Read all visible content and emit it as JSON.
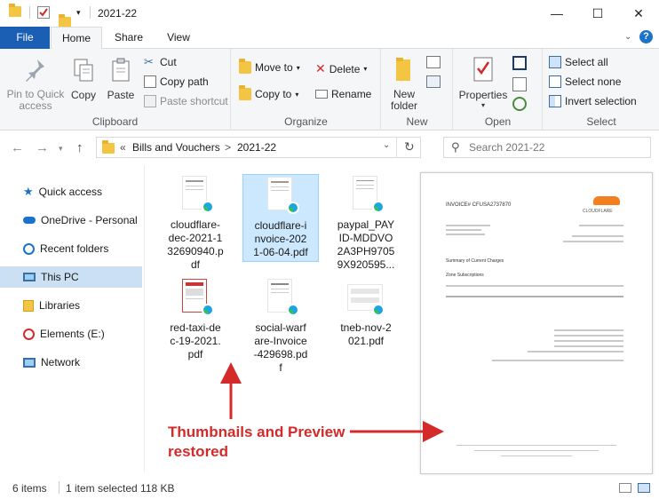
{
  "window": {
    "title": "2021-22",
    "controls": {
      "minimize": "—",
      "maximize": "☐",
      "close": "✕"
    }
  },
  "tabs": {
    "file": "File",
    "home": "Home",
    "share": "Share",
    "view": "View"
  },
  "ribbon": {
    "clipboard": {
      "label": "Clipboard",
      "pin": "Pin to Quick access",
      "copy": "Copy",
      "paste": "Paste",
      "cut": "Cut",
      "copy_path": "Copy path",
      "paste_shortcut": "Paste shortcut"
    },
    "organize": {
      "label": "Organize",
      "move_to": "Move to",
      "copy_to": "Copy to",
      "delete": "Delete",
      "rename": "Rename"
    },
    "new": {
      "label": "New",
      "new_folder": "New folder"
    },
    "open": {
      "label": "Open",
      "properties": "Properties"
    },
    "select": {
      "label": "Select",
      "select_all": "Select all",
      "select_none": "Select none",
      "invert": "Invert selection"
    }
  },
  "address": {
    "breadcrumb_root": "Bills and Vouchers",
    "breadcrumb_current": "2021-22",
    "separator": ">",
    "search_placeholder": "Search 2021-22"
  },
  "sidebar": {
    "items": [
      {
        "label": "Quick access",
        "icon": "star-icon"
      },
      {
        "label": "OneDrive - Personal",
        "icon": "cloud-icon"
      },
      {
        "label": "Recent folders",
        "icon": "recent-folder-icon"
      },
      {
        "label": "This PC",
        "icon": "pc-icon"
      },
      {
        "label": "Libraries",
        "icon": "library-icon"
      },
      {
        "label": "Elements (E:)",
        "icon": "drive-icon"
      },
      {
        "label": "Network",
        "icon": "network-icon"
      }
    ]
  },
  "files": [
    {
      "name": "cloudflare-dec-2021-132690940.pdf",
      "lines": [
        "cloudflare-",
        "dec-2021-1",
        "32690940.p",
        "df"
      ]
    },
    {
      "name": "cloudflare-invoice-2021-06-04.pdf",
      "lines": [
        "cloudflare-i",
        "nvoice-202",
        "1-06-04.pdf"
      ]
    },
    {
      "name": "paypal_PAYID-MDDVO2A3PH97059X920595...",
      "lines": [
        "paypal_PAY",
        "ID-MDDVO",
        "2A3PH9705",
        "9X920595..."
      ]
    },
    {
      "name": "red-taxi-dec-19-2021.pdf",
      "lines": [
        "red-taxi-de",
        "c-19-2021.",
        "pdf"
      ]
    },
    {
      "name": "social-warfare-Invoice-429698.pdf",
      "lines": [
        "social-warf",
        "are-Invoice",
        "-429698.pd",
        "f"
      ]
    },
    {
      "name": "tneb-nov-2021.pdf",
      "lines": [
        "tneb-nov-2",
        "021.pdf"
      ]
    }
  ],
  "preview": {
    "invoice_title": "INVOICE# CFUSA2737870",
    "brand": "CLOUDFLARE",
    "summary": "Summary of Current Charges",
    "zone": "Zone Subscriptions"
  },
  "annotation": {
    "line1": "Thumbnails and Preview",
    "line2": "restored"
  },
  "status": {
    "count": "6 items",
    "selection": "1 item selected  118 KB"
  }
}
